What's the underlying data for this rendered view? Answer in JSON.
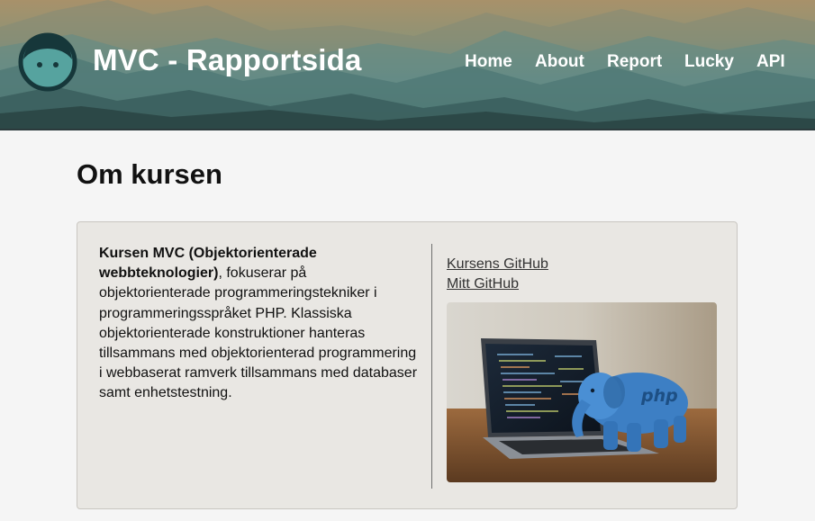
{
  "header": {
    "site_title": "MVC - Rapportsida",
    "logo_icon": "face-avatar-icon",
    "nav": [
      {
        "label": "Home"
      },
      {
        "label": "About"
      },
      {
        "label": "Report"
      },
      {
        "label": "Lucky"
      },
      {
        "label": "API"
      }
    ]
  },
  "main": {
    "page_title": "Om kursen",
    "card": {
      "intro_bold": "Kursen MVC (Objektorienterade webbteknologier)",
      "intro_rest": ", fokuserar på objektorienterade programmeringstekniker i programmeringsspråket PHP. Klassiska objektorienterade konstruktioner hanteras tillsammans med objektorienterad programmering i webbaserat ramverk tillsammans med databaser samt enhetstestning.",
      "links": [
        {
          "label": "Kursens GitHub"
        },
        {
          "label": "Mitt GitHub"
        }
      ],
      "image_icon": "laptop-php-elephant-photo",
      "image_badge_text": "php"
    }
  },
  "colors": {
    "sky_top": "#a58f67",
    "sky_mid": "#5e8f8d",
    "mountain_dark": "#2f4c4c",
    "logo_ring": "#16373a",
    "logo_face": "#56a39f",
    "card_bg": "#e9e7e3",
    "page_bg": "#f5f5f5"
  }
}
